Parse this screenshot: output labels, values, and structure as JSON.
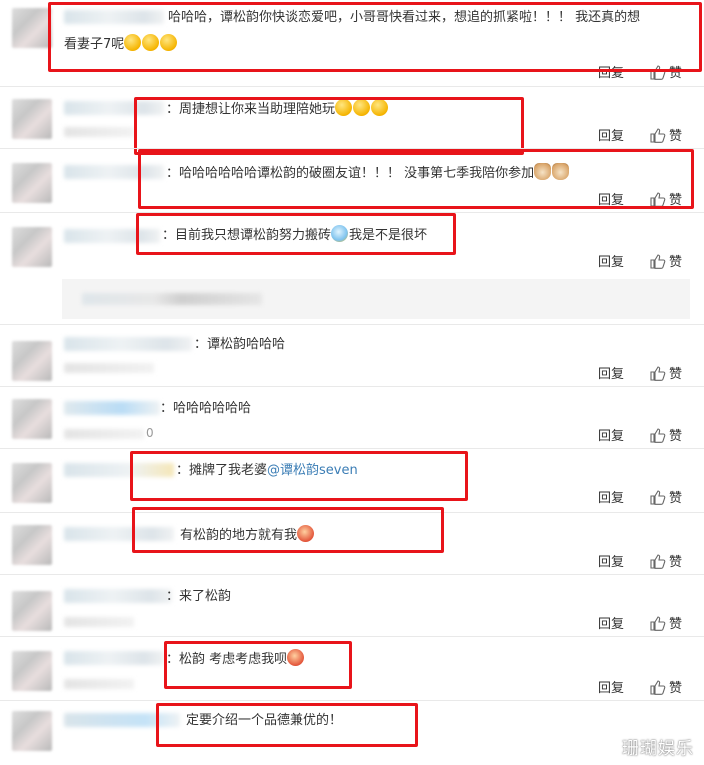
{
  "comments": [
    {
      "text": "哈哈哈，谭松韵你快谈恋爱吧，小哥哥快看过来，想追的抓紧啦！！！ 我还真的想",
      "text2": "看妻子7呢",
      "emojis": [
        "smile",
        "smile",
        "smile"
      ]
    },
    {
      "prefix": "：",
      "text": "周捷想让你来当助理陪她玩",
      "emojis": [
        "laugh",
        "laugh",
        "laugh"
      ]
    },
    {
      "prefix": "：",
      "text": "哈哈哈哈哈哈谭松韵的破圈友谊！！！ 没事第七季我陪你参加",
      "emojis": [
        "cat",
        "cat"
      ]
    },
    {
      "prefix": "：",
      "text": "目前我只想谭松韵努力搬砖",
      "text_after": "我是不是很坏",
      "emojis": [
        "cry"
      ]
    },
    {
      "prefix": "：",
      "text": "谭松韵哈哈哈"
    },
    {
      "prefix": "：",
      "text": "哈哈哈哈哈哈",
      "sub": "0"
    },
    {
      "prefix": "：",
      "text": "摊牌了我老婆",
      "mention": "@谭松韵seven"
    },
    {
      "prefix": "",
      "text": "有松韵的地方就有我",
      "emojis": [
        "cheer"
      ]
    },
    {
      "prefix": "：",
      "text": "来了松韵"
    },
    {
      "prefix": "：",
      "text": "松韵 考虑考虑我呗",
      "emojis": [
        "angry"
      ]
    },
    {
      "prefix": "：",
      "text": "定要介绍一个品德兼优的！"
    }
  ],
  "actions": {
    "reply_label": "回复",
    "like_label": "赞"
  },
  "watermark": "珊瑚娱乐",
  "icons": {
    "like": "thumbs-up-icon"
  },
  "highlight_color": "#e8141a"
}
